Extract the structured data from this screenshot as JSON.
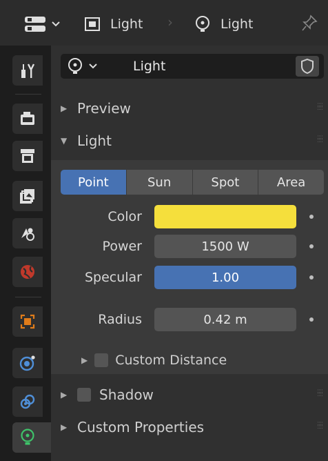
{
  "header": {
    "editor_type_icon": "properties-editor-icon",
    "object_icon": "object-icon",
    "object_name": "Light",
    "data_icon": "light-bulb-icon",
    "data_name": "Light",
    "pin_icon": "pin-icon"
  },
  "tabs": [
    {
      "name": "tab-tool",
      "icon": "tool-icon"
    },
    {
      "name": "tab-render",
      "icon": "render-icon"
    },
    {
      "name": "tab-output",
      "icon": "output-icon"
    },
    {
      "name": "tab-view-layer",
      "icon": "view-layer-icon"
    },
    {
      "name": "tab-scene",
      "icon": "scene-icon"
    },
    {
      "name": "tab-world",
      "icon": "world-icon"
    },
    {
      "name": "tab-object",
      "icon": "object-icon"
    },
    {
      "name": "tab-physics",
      "icon": "physics-icon"
    },
    {
      "name": "tab-constraints",
      "icon": "constraints-icon"
    },
    {
      "name": "tab-light-data",
      "icon": "light-data-icon",
      "active": true
    }
  ],
  "datablock": {
    "name": "Light"
  },
  "panels": {
    "preview": "Preview",
    "light": "Light",
    "shadow": "Shadow",
    "custom_properties": "Custom Properties"
  },
  "light_types": [
    "Point",
    "Sun",
    "Spot",
    "Area"
  ],
  "selected_type": "Point",
  "properties": {
    "color_label": "Color",
    "color_value": "#f5df3c",
    "power_label": "Power",
    "power_value": "1500 W",
    "specular_label": "Specular",
    "specular_value": "1.00",
    "radius_label": "Radius",
    "radius_value": "0.42 m"
  },
  "custom_distance_label": "Custom Distance",
  "colors": {
    "accent_blue": "#4772b3",
    "field_grey": "#545454",
    "orange_object": "#e07c1a",
    "world_red": "#c0392b",
    "light_green": "#3ec46a"
  }
}
